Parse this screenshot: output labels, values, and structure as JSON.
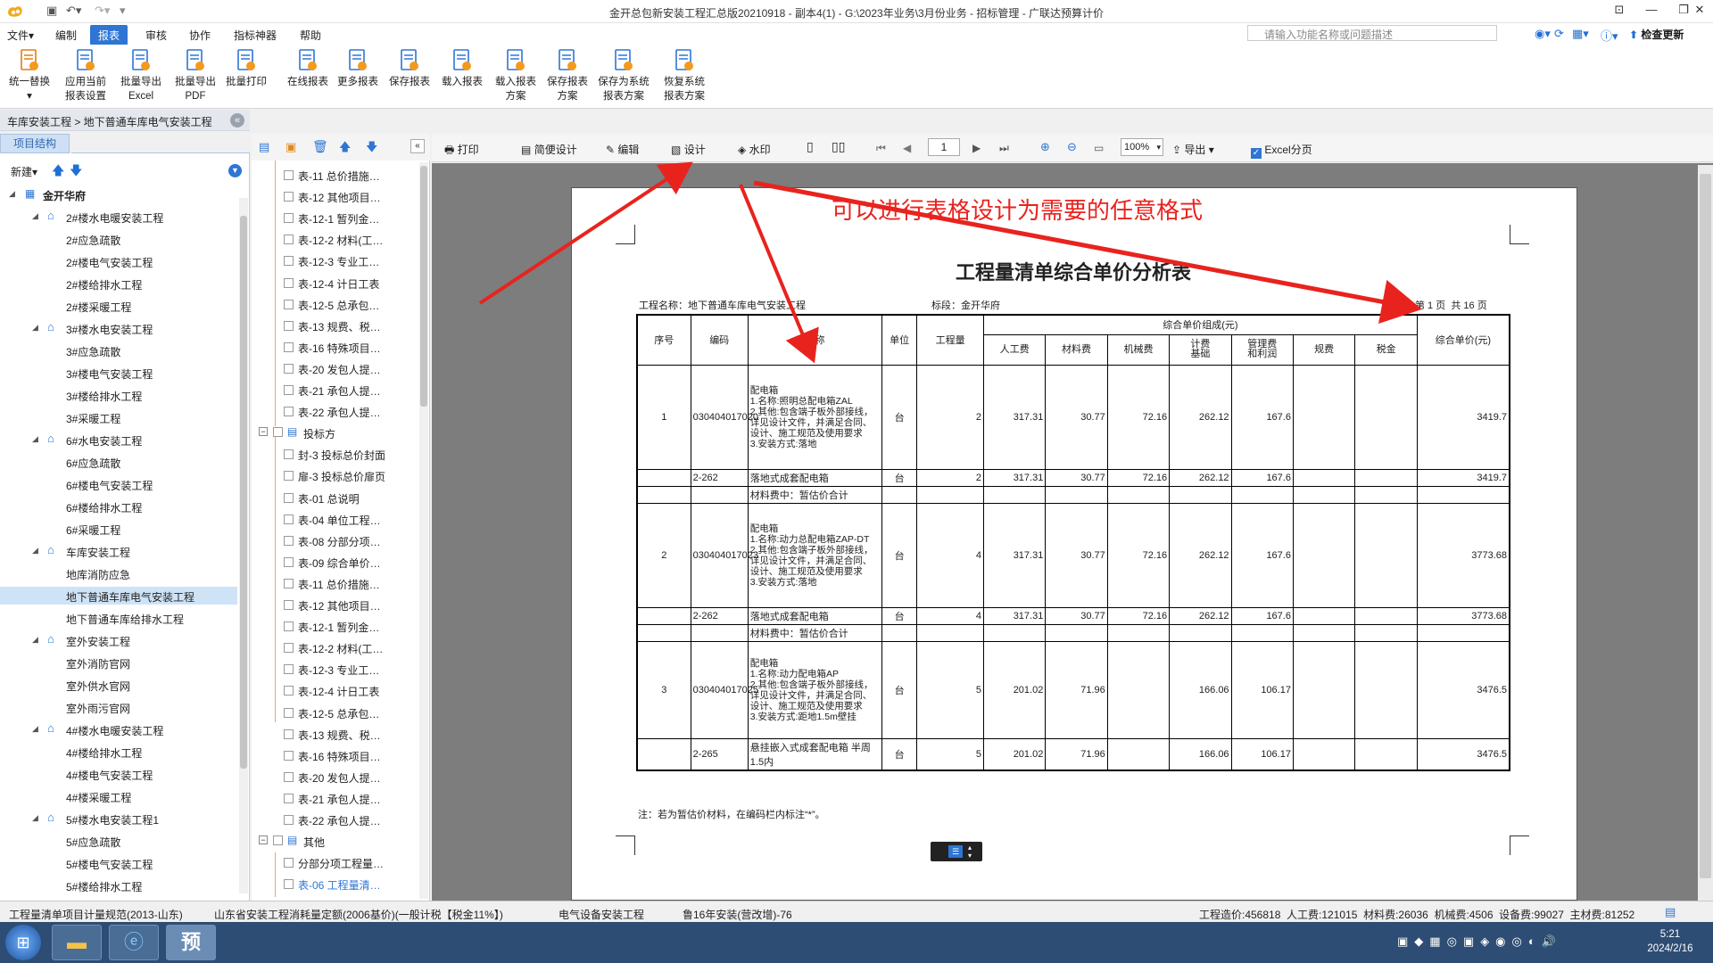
{
  "titlebar": {
    "title": "金开总包新安装工程汇总版20210918 - 副本4(1) - G:\\2023年业务\\3月份业务 - 招标管理 - 广联达预算计价",
    "check_update": "检查更新"
  },
  "menu": {
    "items": [
      "文件▾",
      "编制",
      "报表",
      "审核",
      "协作",
      "指标神器",
      "帮助"
    ],
    "active_index": 2,
    "search_placeholder": "请输入功能名称或问题描述"
  },
  "ribbon": [
    {
      "label1": "统一替换",
      "label2": "▾"
    },
    {
      "label1": "应用当前",
      "label2": "报表设置"
    },
    {
      "label1": "批量导出",
      "label2": "Excel"
    },
    {
      "label1": "批量导出",
      "label2": "PDF"
    },
    {
      "label1": "批量打印",
      "label2": ""
    },
    {
      "label1": "在线报表",
      "label2": ""
    },
    {
      "label1": "更多报表",
      "label2": ""
    },
    {
      "label1": "保存报表",
      "label2": ""
    },
    {
      "label1": "载入报表",
      "label2": ""
    },
    {
      "label1": "载入报表",
      "label2": "方案"
    },
    {
      "label1": "保存报表",
      "label2": "方案"
    },
    {
      "label1": "保存为系统",
      "label2": "报表方案"
    },
    {
      "label1": "恢复系统",
      "label2": "报表方案"
    }
  ],
  "breadcrumb": "车库安装工程 > 地下普通车库电气安装工程",
  "left_panel": {
    "tab": "项目结构",
    "new_label": "新建",
    "tree": [
      {
        "label": "金开华府",
        "level": 0
      },
      {
        "label": "2#楼水电暖安装工程",
        "level": 1
      },
      {
        "label": "2#应急疏散",
        "level": 2
      },
      {
        "label": "2#楼电气安装工程",
        "level": 2
      },
      {
        "label": "2#楼给排水工程",
        "level": 2
      },
      {
        "label": "2#楼采暖工程",
        "level": 2
      },
      {
        "label": "3#楼水电安装工程",
        "level": 1
      },
      {
        "label": "3#应急疏散",
        "level": 2
      },
      {
        "label": "3#楼电气安装工程",
        "level": 2
      },
      {
        "label": "3#楼给排水工程",
        "level": 2
      },
      {
        "label": "3#采暖工程",
        "level": 2
      },
      {
        "label": "6#水电安装工程",
        "level": 1
      },
      {
        "label": "6#应急疏散",
        "level": 2
      },
      {
        "label": "6#楼电气安装工程",
        "level": 2
      },
      {
        "label": "6#楼给排水工程",
        "level": 2
      },
      {
        "label": "6#采暖工程",
        "level": 2
      },
      {
        "label": "车库安装工程",
        "level": 1
      },
      {
        "label": "地库消防应急",
        "level": 2
      },
      {
        "label": "地下普通车库电气安装工程",
        "level": 2,
        "selected": true
      },
      {
        "label": "地下普通车库给排水工程",
        "level": 2
      },
      {
        "label": "室外安装工程",
        "level": 1
      },
      {
        "label": "室外消防官网",
        "level": 2
      },
      {
        "label": "室外供水官网",
        "level": 2
      },
      {
        "label": "室外雨污官网",
        "level": 2
      },
      {
        "label": "4#楼水电暖安装工程",
        "level": 1
      },
      {
        "label": "4#楼给排水工程",
        "level": 2
      },
      {
        "label": "4#楼电气安装工程",
        "level": 2
      },
      {
        "label": "4#楼采暖工程",
        "level": 2
      },
      {
        "label": "5#楼水电安装工程1",
        "level": 1
      },
      {
        "label": "5#应急疏散",
        "level": 2
      },
      {
        "label": "5#楼电气安装工程",
        "level": 2
      },
      {
        "label": "5#楼给排水工程",
        "level": 2
      }
    ]
  },
  "middle_panel": {
    "items": [
      {
        "label": "表-11 总价措施…",
        "kind": "leaf"
      },
      {
        "label": "表-12 其他项目…",
        "kind": "leaf"
      },
      {
        "label": "表-12-1 暂列金…",
        "kind": "leaf"
      },
      {
        "label": "表-12-2 材料(工…",
        "kind": "leaf"
      },
      {
        "label": "表-12-3 专业工…",
        "kind": "leaf"
      },
      {
        "label": "表-12-4 计日工表",
        "kind": "leaf"
      },
      {
        "label": "表-12-5 总承包…",
        "kind": "leaf"
      },
      {
        "label": "表-13 规费、税…",
        "kind": "leaf"
      },
      {
        "label": "表-16 特殊项目…",
        "kind": "leaf"
      },
      {
        "label": "表-20 发包人提…",
        "kind": "leaf"
      },
      {
        "label": "表-21 承包人提…",
        "kind": "leaf"
      },
      {
        "label": "表-22 承包人提…",
        "kind": "leaf"
      },
      {
        "label": "投标方",
        "kind": "group"
      },
      {
        "label": "封-3 投标总价封面",
        "kind": "leaf"
      },
      {
        "label": "扉-3 投标总价扉页",
        "kind": "leaf"
      },
      {
        "label": "表-01 总说明",
        "kind": "leaf"
      },
      {
        "label": "表-04 单位工程…",
        "kind": "leaf"
      },
      {
        "label": "表-08 分部分项…",
        "kind": "leaf"
      },
      {
        "label": "表-09 综合单价…",
        "kind": "leaf"
      },
      {
        "label": "表-11 总价措施…",
        "kind": "leaf"
      },
      {
        "label": "表-12 其他项目…",
        "kind": "leaf"
      },
      {
        "label": "表-12-1 暂列金…",
        "kind": "leaf"
      },
      {
        "label": "表-12-2 材料(工…",
        "kind": "leaf"
      },
      {
        "label": "表-12-3 专业工…",
        "kind": "leaf"
      },
      {
        "label": "表-12-4 计日工表",
        "kind": "leaf"
      },
      {
        "label": "表-12-5 总承包…",
        "kind": "leaf"
      },
      {
        "label": "表-13 规费、税…",
        "kind": "leaf"
      },
      {
        "label": "表-16 特殊项目…",
        "kind": "leaf"
      },
      {
        "label": "表-20 发包人提…",
        "kind": "leaf"
      },
      {
        "label": "表-21 承包人提…",
        "kind": "leaf"
      },
      {
        "label": "表-22 承包人提…",
        "kind": "leaf"
      },
      {
        "label": "其他",
        "kind": "group"
      },
      {
        "label": "分部分项工程量…",
        "kind": "leaf"
      },
      {
        "label": "表-06 工程量清…",
        "kind": "leaf",
        "active": true
      }
    ]
  },
  "report_toolbar": {
    "print": "打印",
    "simple_design": "简便设计",
    "edit": "编辑",
    "design": "设计",
    "watermark": "水印",
    "page": "1",
    "zoom": "100%",
    "export": "导出",
    "excel_pages": "Excel分页"
  },
  "annotation": "可以进行表格设计为需要的任意格式",
  "report": {
    "title": "工程量清单综合单价分析表",
    "project_name": "工程名称：地下普通车库电气安装工程",
    "section": "标段：金开华府",
    "page_info": "第 1 页  共 16 页",
    "headers": {
      "seq": "序号",
      "code": "编码",
      "name": "名称",
      "unit": "单位",
      "qty": "工程量",
      "group": "综合单价组成(元)",
      "labor": "人工费",
      "material": "材料费",
      "machine": "机械费",
      "fee_base": "计费\n基础",
      "mgmt": "管理费\n和利润",
      "regfee": "规费",
      "tax": "税金",
      "unit_price": "综合单价(元)"
    },
    "rows": [
      {
        "seq": "1",
        "code": "030404017020",
        "name": "配电箱\n1.名称:照明总配电箱ZAL\n2.其他:包含端子板外部接线，详见设计文件，并满足合同、设计、施工规范及使用要求\n3.安装方式:落地",
        "unit": "台",
        "qty": "2",
        "labor": "317.31",
        "material": "30.77",
        "machine": "72.16",
        "fee_base": "262.12",
        "mgmt": "167.6",
        "regfee": "",
        "tax": "",
        "price": "3419.7",
        "kind": "main"
      },
      {
        "seq": "",
        "code": "2-262",
        "name": "落地式成套配电箱",
        "unit": "台",
        "qty": "2",
        "labor": "317.31",
        "material": "30.77",
        "machine": "72.16",
        "fee_base": "262.12",
        "mgmt": "167.6",
        "regfee": "",
        "tax": "",
        "price": "3419.7",
        "kind": "sub"
      },
      {
        "seq": "",
        "code": "",
        "name": "材料费中：暂估价合计",
        "unit": "",
        "qty": "",
        "labor": "",
        "material": "",
        "machine": "",
        "fee_base": "",
        "mgmt": "",
        "regfee": "",
        "tax": "",
        "price": "",
        "kind": "note"
      },
      {
        "seq": "2",
        "code": "030404017023",
        "name": "配电箱\n1.名称:动力总配电箱ZAP-DT\n2.其他:包含端子板外部接线，详见设计文件，并满足合同、设计、施工规范及使用要求\n3.安装方式:落地",
        "unit": "台",
        "qty": "4",
        "labor": "317.31",
        "material": "30.77",
        "machine": "72.16",
        "fee_base": "262.12",
        "mgmt": "167.6",
        "regfee": "",
        "tax": "",
        "price": "3773.68",
        "kind": "main"
      },
      {
        "seq": "",
        "code": "2-262",
        "name": "落地式成套配电箱",
        "unit": "台",
        "qty": "4",
        "labor": "317.31",
        "material": "30.77",
        "machine": "72.16",
        "fee_base": "262.12",
        "mgmt": "167.6",
        "regfee": "",
        "tax": "",
        "price": "3773.68",
        "kind": "sub"
      },
      {
        "seq": "",
        "code": "",
        "name": "材料费中：暂估价合计",
        "unit": "",
        "qty": "",
        "labor": "",
        "material": "",
        "machine": "",
        "fee_base": "",
        "mgmt": "",
        "regfee": "",
        "tax": "",
        "price": "",
        "kind": "note"
      },
      {
        "seq": "3",
        "code": "030404017025",
        "name": "配电箱\n1.名称:动力配电箱AP\n2.其他:包含端子板外部接线，详见设计文件，并满足合同、设计、施工规范及使用要求\n3.安装方式:距地1.5m壁挂",
        "unit": "台",
        "qty": "5",
        "labor": "201.02",
        "material": "71.96",
        "machine": "",
        "fee_base": "166.06",
        "mgmt": "106.17",
        "regfee": "",
        "tax": "",
        "price": "3476.5",
        "kind": "main"
      },
      {
        "seq": "",
        "code": "2-265",
        "name": "悬挂嵌入式成套配电箱 半周1.5内",
        "unit": "台",
        "qty": "5",
        "labor": "201.02",
        "material": "71.96",
        "machine": "",
        "fee_base": "166.06",
        "mgmt": "106.17",
        "regfee": "",
        "tax": "",
        "price": "3476.5",
        "kind": "sub"
      }
    ],
    "footnote": "注：若为暂估价材料，在编码栏内标注“*”。"
  },
  "statusbar": {
    "spec": "工程量清单项目计量规范(2013-山东)",
    "quota": "山东省安装工程消耗量定额(2006基价)(一般计税【税金11%】)",
    "major": "电气设备安装工程",
    "rate": "鲁16年安装(营改增)-76",
    "totals": "工程造价:456818  人工费:121015  材料费:26036  机械费:4506  设备费:99027  主材费:81252"
  },
  "taskbar": {
    "app_label": "预",
    "time": "5:21",
    "date": "2024/2/16"
  },
  "colors": {
    "accent": "#2e75d4",
    "annotation_red": "#e8231e",
    "selected_bg": "#cfe3f7",
    "taskbar": "#2e4d74"
  }
}
